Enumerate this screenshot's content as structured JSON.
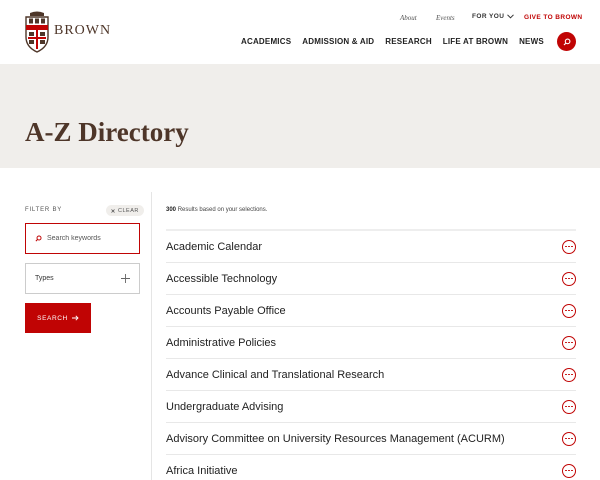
{
  "header": {
    "logo_text": "BROWN",
    "util": {
      "about": "About",
      "events": "Events",
      "for_you": "FOR YOU",
      "give": "GIVE TO BROWN"
    },
    "nav": [
      "ACADEMICS",
      "ADMISSION & AID",
      "RESEARCH",
      "LIFE AT BROWN",
      "NEWS"
    ]
  },
  "hero": {
    "title": "A-Z Directory"
  },
  "sidebar": {
    "filter_label": "FILTER BY",
    "clear_label": "CLEAR",
    "keyword_placeholder": "Search keywords",
    "types_label": "Types",
    "search_label": "SEARCH"
  },
  "results": {
    "count": "300",
    "count_suffix": "Results based on your selections.",
    "items": [
      "Academic Calendar",
      "Accessible Technology",
      "Accounts Payable Office",
      "Administrative Policies",
      "Advance Clinical and Translational Research",
      "Undergraduate Advising",
      "Advisory Committee on University Resources Management (ACURM)",
      "Africa Initiative"
    ]
  },
  "colors": {
    "brand_red": "#c00404",
    "brown": "#4e3629",
    "hero_bg": "#f0eeeb"
  },
  "icons": [
    "brown-shield-logo",
    "search-icon",
    "chevron-down-icon",
    "plus-icon",
    "arrow-right-icon",
    "more-icon",
    "close-icon"
  ]
}
